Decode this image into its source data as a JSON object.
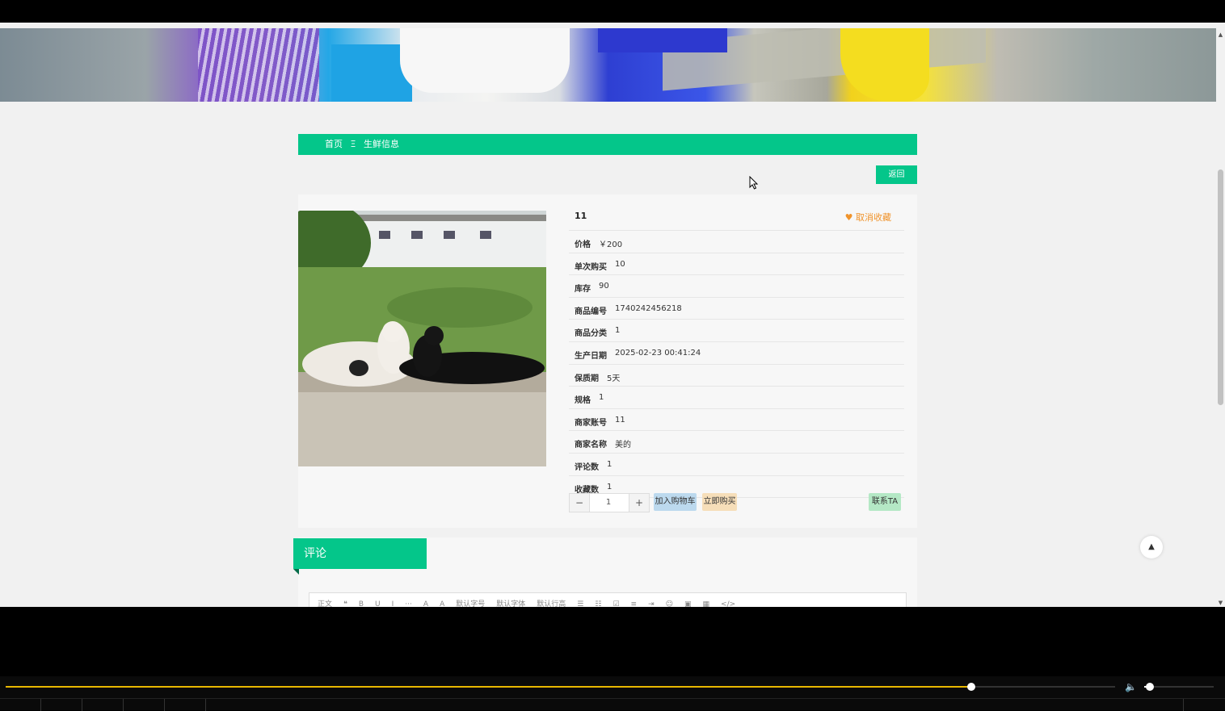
{
  "breadcrumb": {
    "home": "首页",
    "separator": "Ξ",
    "current": "生鲜信息"
  },
  "back_label": "返回",
  "product": {
    "name": "11",
    "favorite_label": "取消收藏",
    "fields": [
      {
        "label": "价格",
        "value": "￥200",
        "highlight": true
      },
      {
        "label": "单次购买",
        "value": "10"
      },
      {
        "label": "库存",
        "value": "90"
      },
      {
        "label": "商品编号",
        "value": "1740242456218"
      },
      {
        "label": "商品分类",
        "value": "1"
      },
      {
        "label": "生产日期",
        "value": "2025-02-23 00:41:24"
      },
      {
        "label": "保质期",
        "value": "5天"
      },
      {
        "label": "规格",
        "value": "1"
      },
      {
        "label": "商家账号",
        "value": "11"
      },
      {
        "label": "商家名称",
        "value": "美的"
      },
      {
        "label": "评论数",
        "value": "1"
      },
      {
        "label": "收藏数",
        "value": "1"
      }
    ],
    "quantity": "1",
    "minus": "−",
    "plus": "+",
    "add_to_cart": "加入购物车",
    "buy_now": "立即购买",
    "contact": "联系TA"
  },
  "comments": {
    "title": "评论",
    "toolbar": [
      "正文",
      "❝",
      "B",
      "U",
      "I",
      "···",
      "A",
      "A",
      "默认字号",
      "默认字体",
      "默认行高",
      "☰",
      "☷",
      "☑",
      "≡",
      "⇥",
      "☺",
      "▣",
      "▦",
      "</>"
    ]
  },
  "player": {
    "progress": 0.87,
    "volume": 0.08
  },
  "colors": {
    "accent": "#04c68a",
    "price": "#dd2222",
    "favorite": "#f0932b"
  },
  "icons": {
    "favorite": "heart-icon",
    "back_to_top": "chevron-up-icon",
    "volume": "speaker-icon"
  }
}
